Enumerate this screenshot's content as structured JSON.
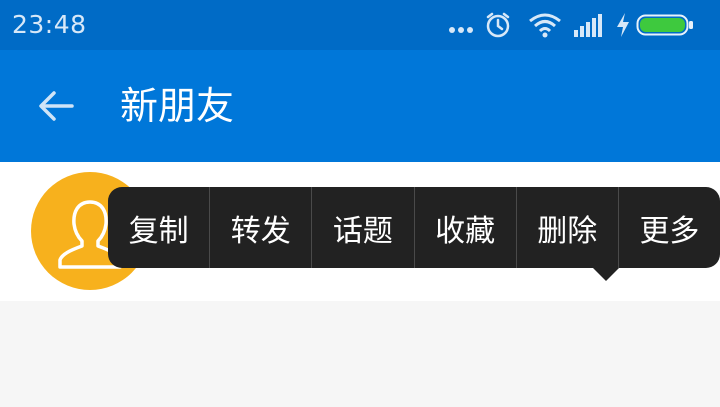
{
  "status_bar": {
    "time": "23:48",
    "icons": [
      "more-dots-icon",
      "alarm-clock-icon",
      "wifi-icon",
      "signal-icon",
      "charging-bolt-icon",
      "battery-icon"
    ],
    "battery_level": 1.0,
    "battery_color": "#3ec93e"
  },
  "app_bar": {
    "title": "新朋友",
    "back_icon": "back-arrow-icon",
    "background": "#0077d9"
  },
  "friend_row": {
    "avatar_icon": "person-silhouette-icon",
    "avatar_color": "#f7b11d"
  },
  "context_menu": {
    "items": [
      "复制",
      "转发",
      "话题",
      "收藏",
      "删除",
      "更多"
    ]
  }
}
